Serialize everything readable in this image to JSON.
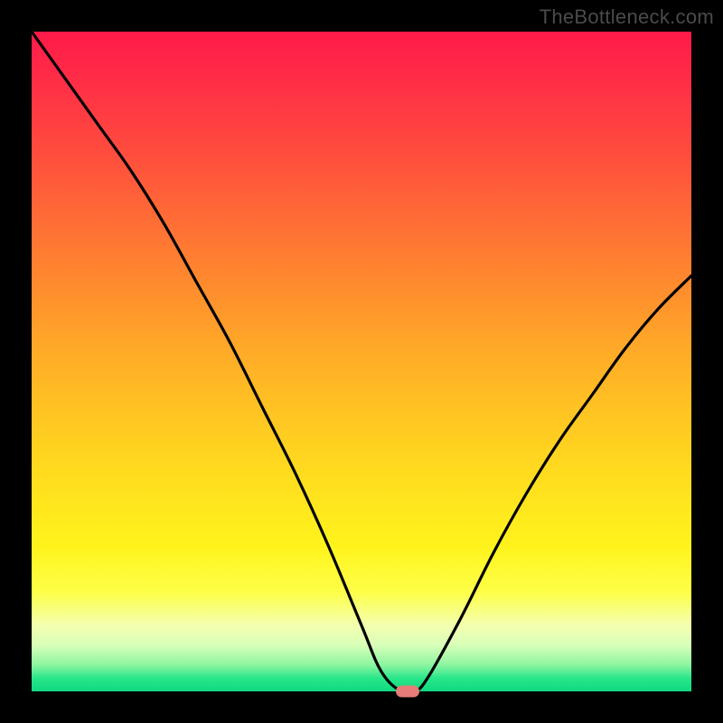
{
  "watermark": "TheBottleneck.com",
  "colors": {
    "accent_marker": "#e77c78",
    "curve": "#000000"
  },
  "chart_data": {
    "type": "line",
    "title": "",
    "xlabel": "",
    "ylabel": "",
    "xlim": [
      0,
      100
    ],
    "ylim": [
      0,
      100
    ],
    "grid": false,
    "series": [
      {
        "name": "bottleneck-curve",
        "x": [
          0,
          5,
          10,
          15,
          20,
          25,
          30,
          35,
          40,
          45,
          50,
          53,
          56,
          58,
          60,
          65,
          70,
          75,
          80,
          85,
          90,
          95,
          100
        ],
        "values": [
          100,
          93,
          86,
          79,
          71,
          62,
          53,
          43,
          33,
          22,
          10,
          3,
          0,
          0,
          2,
          11,
          21,
          30,
          38,
          45,
          52,
          58,
          63
        ]
      }
    ],
    "marker": {
      "x": 57,
      "y": 0
    },
    "gradient_stops": [
      {
        "pos": 0,
        "color": "#ff1a49"
      },
      {
        "pos": 28,
        "color": "#ff6b36"
      },
      {
        "pos": 58,
        "color": "#ffc522"
      },
      {
        "pos": 85,
        "color": "#fdff48"
      },
      {
        "pos": 96,
        "color": "#8cf5a1"
      },
      {
        "pos": 100,
        "color": "#0fd97f"
      }
    ]
  }
}
